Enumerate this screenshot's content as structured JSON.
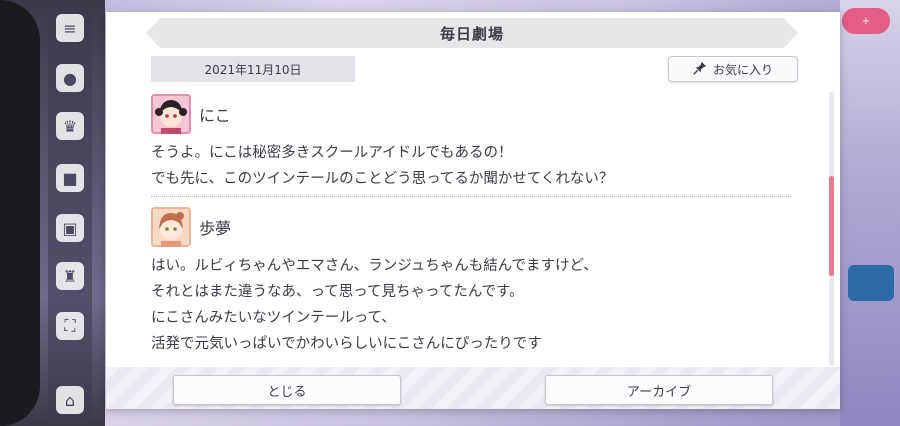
{
  "dialog": {
    "title": "毎日劇場",
    "date": "2021年11月10日",
    "favorite_label": "お気に入り",
    "favorite_icon": "pin-icon"
  },
  "entries": [
    {
      "speaker": "にこ",
      "lines": [
        "そうよ。にこは秘密多きスクールアイドルでもあるの！",
        "でも先に、このツインテールのことどう思ってるか聞かせてくれない？"
      ]
    },
    {
      "speaker": "歩夢",
      "lines": [
        "はい。ルビィちゃんやエマさん、ランジュちゃんも結んでますけど、",
        "それとはまた違うなあ、って思って見ちゃってたんです。",
        "にこさんみたいなツインテールって、",
        "活発で元気いっぱいでかわいらしいにこさんにぴったりです"
      ]
    }
  ],
  "buttons": {
    "close_label": "とじる",
    "archive_label": "アーカイブ"
  },
  "colors": {
    "accent_scroll": "#e87a95",
    "niko_avatar_bg": "#f6c6d4",
    "ayumu_avatar_bg": "#f8d9c4"
  }
}
